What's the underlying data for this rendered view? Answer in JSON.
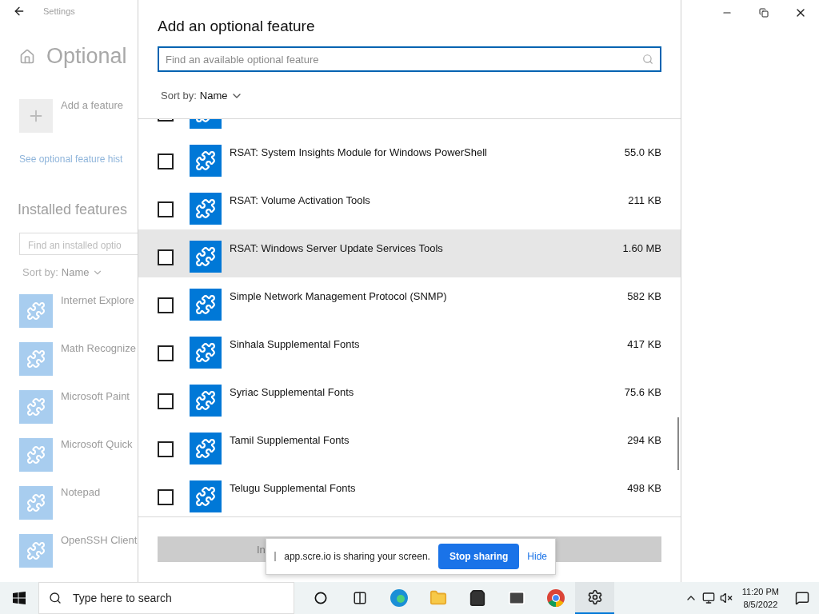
{
  "settings": {
    "title": "Settings",
    "heading": "Optional",
    "add_feature": "Add a feature",
    "history_link": "See optional feature hist",
    "installed_heading": "Installed features",
    "search": {
      "placeholder": "Find an installed optio"
    },
    "sort_label": "Sort by:",
    "sort_value": "Name",
    "installed": [
      {
        "name": "Internet Explore"
      },
      {
        "name": "Math Recognize"
      },
      {
        "name": "Microsoft Paint"
      },
      {
        "name": "Microsoft Quick"
      },
      {
        "name": "Notepad"
      },
      {
        "name": "OpenSSH Client"
      }
    ]
  },
  "dialog": {
    "title": "Add an optional feature",
    "search": {
      "placeholder": "Find an available optional feature"
    },
    "sort_label": "Sort by:",
    "sort_value": "Name",
    "features": [
      {
        "checked": false,
        "selected": false
      },
      {
        "name": "RSAT: System Insights Module for Windows PowerShell",
        "size": "55.0 KB",
        "checked": false,
        "selected": false
      },
      {
        "name": "RSAT: Volume Activation Tools",
        "size": "211 KB",
        "checked": false,
        "selected": false
      },
      {
        "name": "RSAT: Windows Server Update Services Tools",
        "size": "1.60 MB",
        "checked": false,
        "selected": true
      },
      {
        "name": "Simple Network Management Protocol (SNMP)",
        "size": "582 KB",
        "checked": false,
        "selected": false
      },
      {
        "name": "Sinhala Supplemental Fonts",
        "size": "417 KB",
        "checked": false,
        "selected": false
      },
      {
        "name": "Syriac Supplemental Fonts",
        "size": "75.6 KB",
        "checked": false,
        "selected": false
      },
      {
        "name": "Tamil Supplemental Fonts",
        "size": "294 KB",
        "checked": false,
        "selected": false
      },
      {
        "name": "Telugu Supplemental Fonts",
        "size": "498 KB",
        "checked": false,
        "selected": false
      }
    ],
    "install_button": "In"
  },
  "sharing_bar": {
    "message": "app.scre.io is sharing your screen.",
    "stop_button": "Stop sharing",
    "hide_link": "Hide"
  },
  "taskbar": {
    "search": {
      "placeholder": "Type here to search"
    },
    "time": "11:20 PM",
    "date": "8/5/2022"
  }
}
